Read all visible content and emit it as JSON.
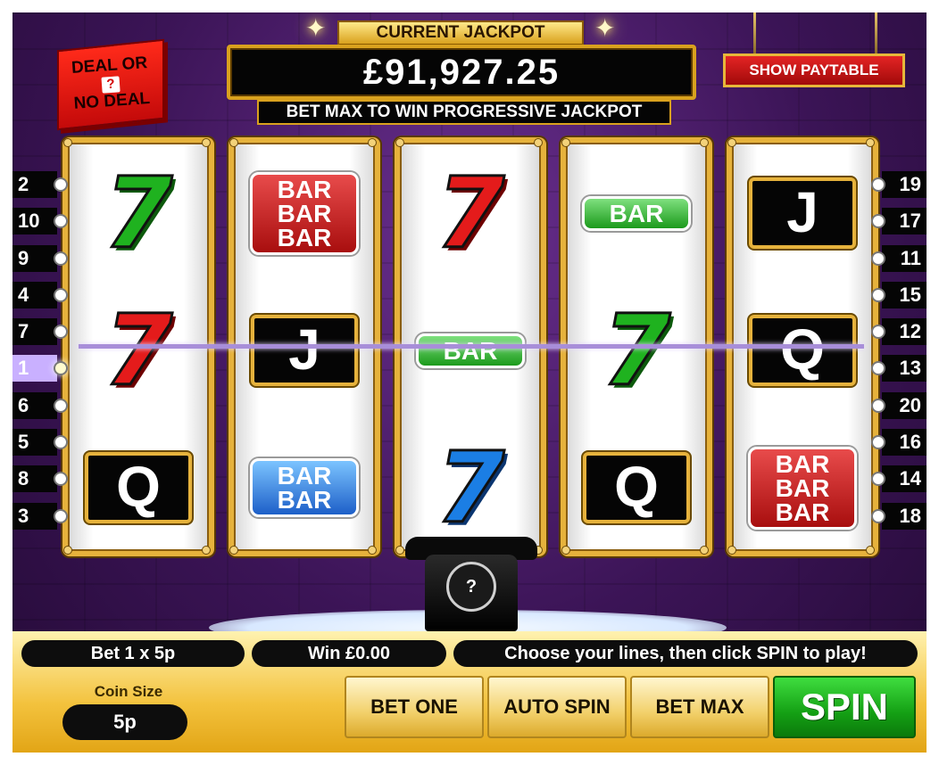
{
  "logo": {
    "line1": "DEAL OR",
    "mark": "?",
    "line2": "NO DEAL"
  },
  "jackpot": {
    "label": "CURRENT JACKPOT",
    "amount": "£91,927.25",
    "subtitle": "BET MAX TO WIN PROGRESSIVE JACKPOT"
  },
  "paytable_button": "SHOW PAYTABLE",
  "reels": [
    {
      "symbols": [
        {
          "kind": "seven",
          "color": "green",
          "text": "7"
        },
        {
          "kind": "seven",
          "color": "red",
          "text": "7"
        },
        {
          "kind": "letter",
          "text": "Q"
        }
      ]
    },
    {
      "symbols": [
        {
          "kind": "bars",
          "color": "red",
          "lines": [
            "BAR",
            "BAR",
            "BAR"
          ]
        },
        {
          "kind": "letter",
          "text": "J"
        },
        {
          "kind": "bars",
          "color": "blue",
          "lines": [
            "BAR",
            "BAR"
          ]
        }
      ]
    },
    {
      "symbols": [
        {
          "kind": "seven",
          "color": "red",
          "text": "7"
        },
        {
          "kind": "bars",
          "color": "green",
          "lines": [
            "BAR"
          ]
        },
        {
          "kind": "seven",
          "color": "blue",
          "text": "7"
        }
      ]
    },
    {
      "symbols": [
        {
          "kind": "bars",
          "color": "green",
          "lines": [
            "BAR"
          ]
        },
        {
          "kind": "seven",
          "color": "green",
          "text": "7"
        },
        {
          "kind": "letter",
          "text": "Q"
        }
      ]
    },
    {
      "symbols": [
        {
          "kind": "letter",
          "text": "J"
        },
        {
          "kind": "letter",
          "text": "Q"
        },
        {
          "kind": "bars",
          "color": "red",
          "lines": [
            "BAR",
            "BAR",
            "BAR"
          ]
        }
      ]
    }
  ],
  "paylines": {
    "left": [
      "2",
      "10",
      "9",
      "4",
      "7",
      "1",
      "6",
      "5",
      "8",
      "3"
    ],
    "right": [
      "19",
      "17",
      "11",
      "15",
      "12",
      "13",
      "20",
      "16",
      "14",
      "18"
    ],
    "active_line": "1"
  },
  "phone": {
    "dial": "?"
  },
  "status": {
    "bet": "Bet 1 x 5p",
    "win": "Win £0.00",
    "message": "Choose your lines, then click SPIN to play!"
  },
  "coin_size": {
    "label": "Coin Size",
    "value": "5p"
  },
  "buttons": {
    "bet_one": "BET ONE",
    "auto_spin": "AUTO SPIN",
    "bet_max": "BET MAX",
    "spin": "SPIN"
  },
  "colors": {
    "gold": "#e6b23c",
    "purple": "#3b1456",
    "spin_green": "#14a014",
    "jackpot_red": "#c40a0a"
  }
}
